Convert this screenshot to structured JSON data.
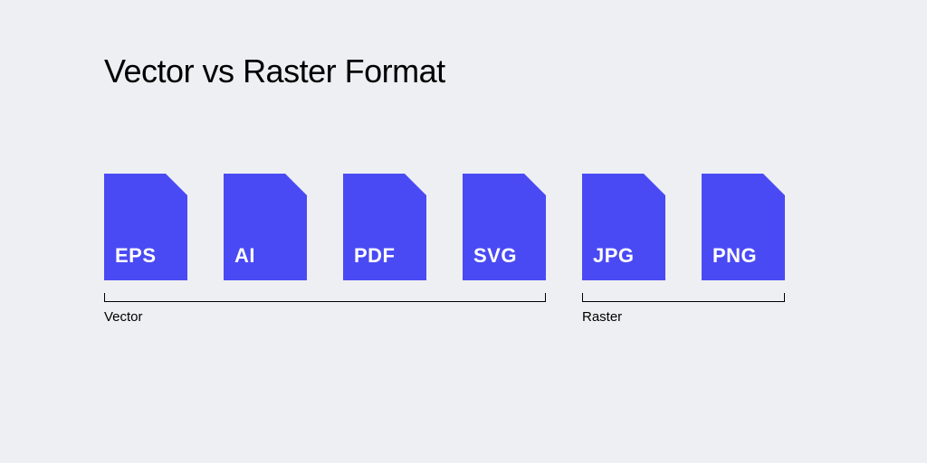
{
  "title": "Vector vs Raster Format",
  "groups": [
    {
      "label": "Vector",
      "files": [
        "EPS",
        "AI",
        "PDF",
        "SVG"
      ]
    },
    {
      "label": "Raster",
      "files": [
        "JPG",
        "PNG"
      ]
    }
  ],
  "colors": {
    "icon_fill": "#4a4af4",
    "background": "#eeeff2"
  }
}
